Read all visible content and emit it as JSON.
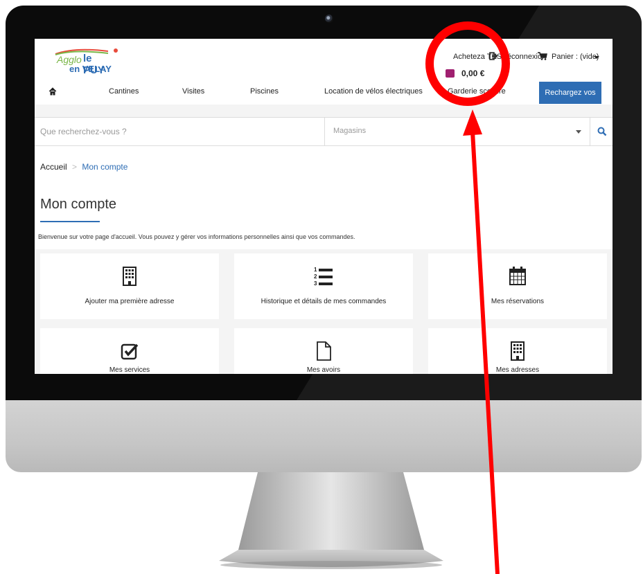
{
  "logo": {
    "line1": "Agglo",
    "line2": "le PUY",
    "line3": "en VELAY"
  },
  "header": {
    "user_name": "Acheteza TEST",
    "logout_label": "Déconnexion",
    "cart_label": "Panier : (vide)",
    "balance": "0,00 €"
  },
  "nav": {
    "items": [
      {
        "label": "Cantines"
      },
      {
        "label": "Visites"
      },
      {
        "label": "Piscines"
      },
      {
        "label": "Location de vélos électriques"
      },
      {
        "label": "Garderie scolaire"
      }
    ],
    "recharge_label": "Rechargez vos crédits"
  },
  "search": {
    "placeholder": "Que recherchez-vous ?",
    "store_value": "Magasins"
  },
  "breadcrumb": {
    "home": "Accueil",
    "separator": ">",
    "current": "Mon compte"
  },
  "page": {
    "title": "Mon compte",
    "welcome": "Bienvenue sur votre page d'accueil. Vous pouvez y gérer vos informations personnelles ainsi que vos commandes."
  },
  "cards": [
    {
      "label": "Ajouter ma première adresse",
      "icon": "building-icon"
    },
    {
      "label": "Historique et détails de mes commandes",
      "icon": "ordered-list-icon"
    },
    {
      "label": "Mes réservations",
      "icon": "calendar-icon"
    },
    {
      "label": "Mes services",
      "icon": "checkbox-icon"
    },
    {
      "label": "Mes avoirs",
      "icon": "file-icon"
    },
    {
      "label": "Mes adresses",
      "icon": "building-icon"
    }
  ],
  "colors": {
    "brand_blue": "#2e6db4",
    "annotation_red": "#ff0000",
    "wallet": "#a02070"
  }
}
